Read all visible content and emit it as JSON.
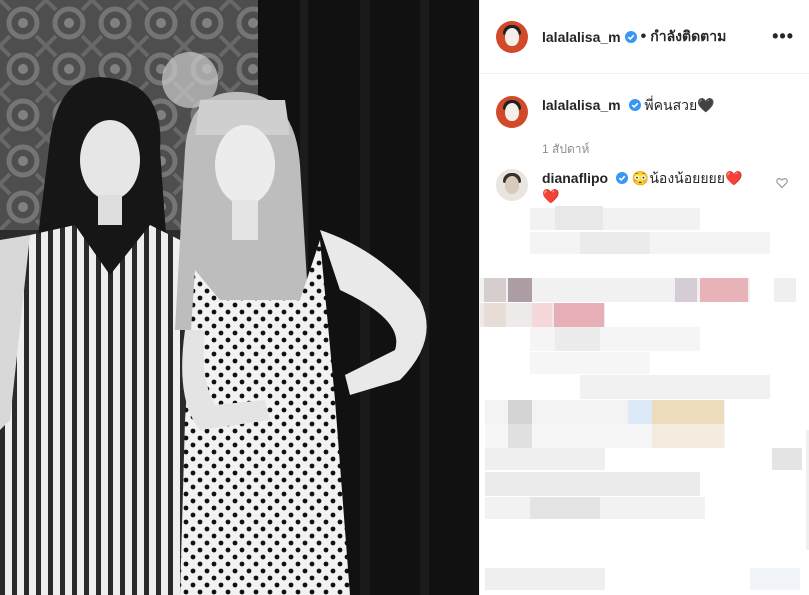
{
  "post": {
    "author": "lalalalisa_m",
    "follow_status": "กำลังติดตาม",
    "more_label": "•••",
    "caption": "พี่คนสวย🖤",
    "time": "1 สัปดาห์"
  },
  "comments": [
    {
      "author": "dianaflipo",
      "text": "😳น้องน้อยยยย❤️\n❤️"
    }
  ],
  "colors": {
    "verified": "#3897f0",
    "text": "#262626",
    "muted": "#8e8e8e",
    "avatar_bg": "#d34a2b"
  },
  "icons": [
    "verified-badge-icon",
    "more-options-icon",
    "heart-icon"
  ]
}
